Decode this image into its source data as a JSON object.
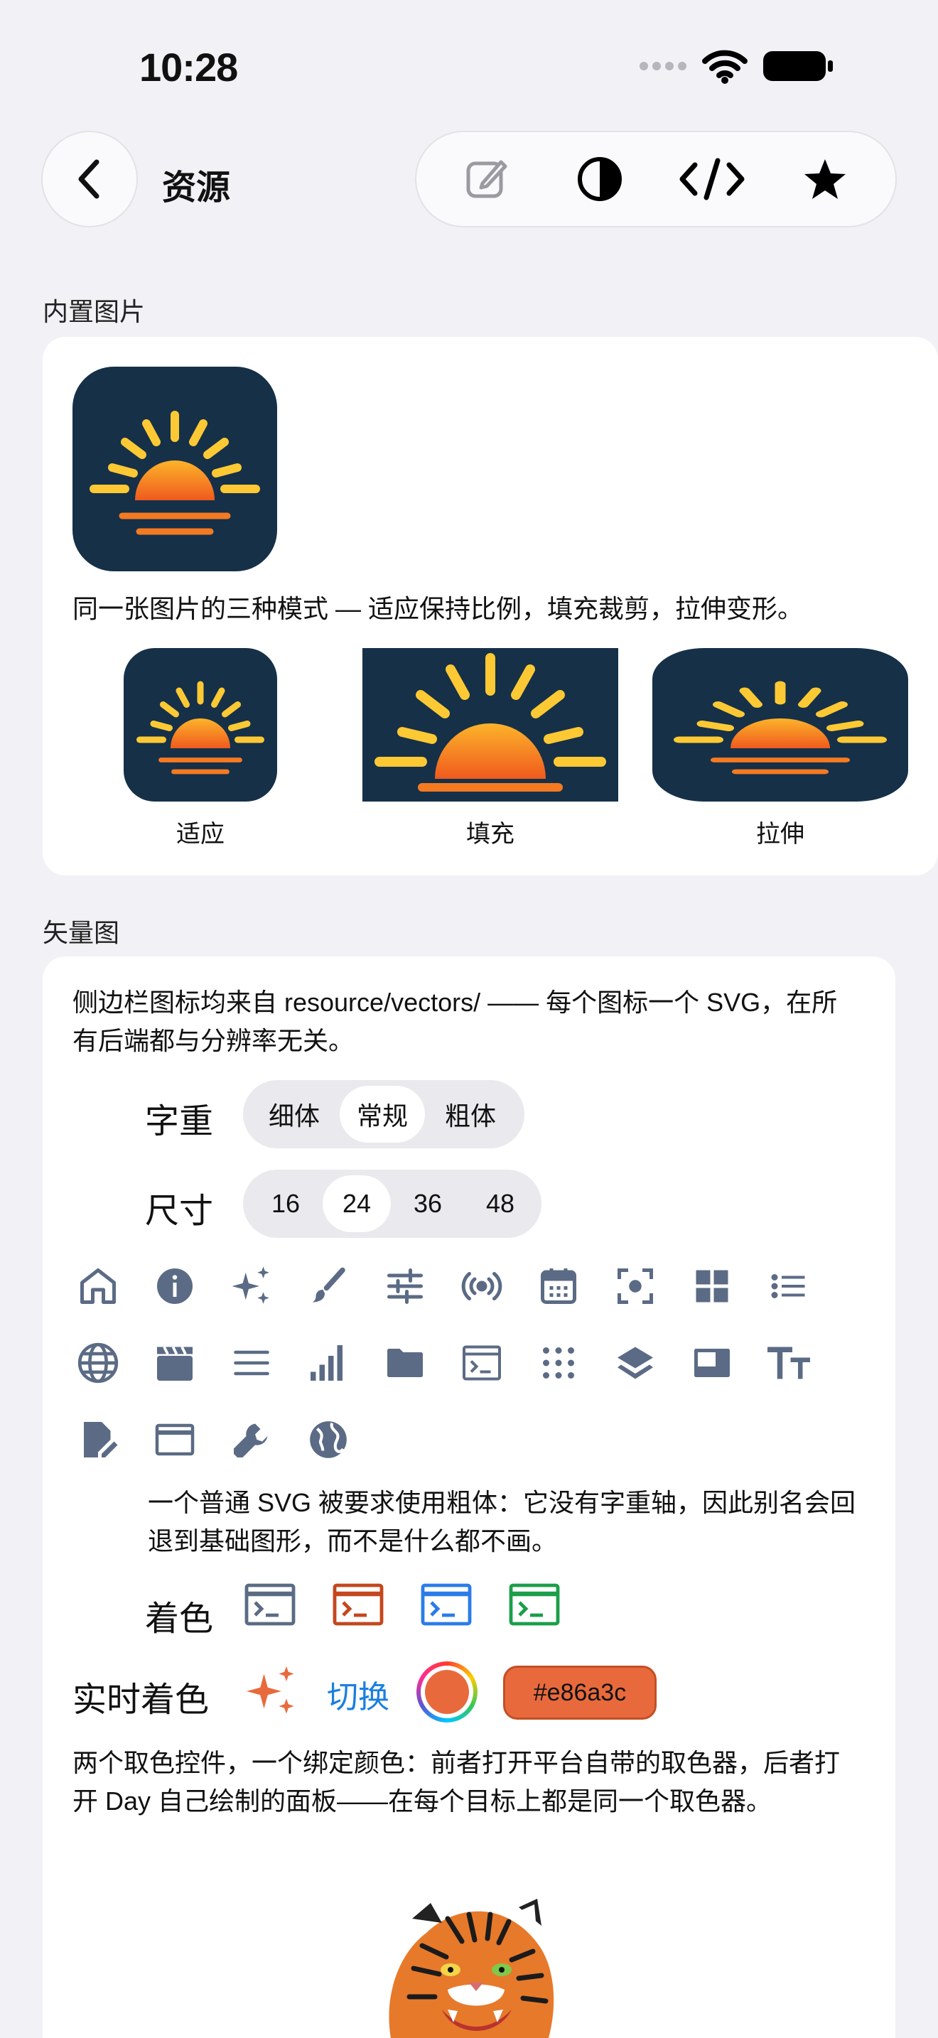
{
  "status": {
    "time": "10:28"
  },
  "nav": {
    "title": "资源"
  },
  "builtin": {
    "section_label": "内置图片",
    "description": "同一张图片的三种模式 — 适应保持比例，填充裁剪，拉伸变形。",
    "modes": [
      "适应",
      "填充",
      "拉伸"
    ]
  },
  "vectors": {
    "section_label": "矢量图",
    "intro": "侧边栏图标均来自 resource/vectors/ —— 每个图标一个 SVG，在所有后端都与分辨率无关。",
    "weight_label": "字重",
    "weights": [
      "细体",
      "常规",
      "粗体"
    ],
    "weight_selected": "常规",
    "size_label": "尺寸",
    "sizes": [
      "16",
      "24",
      "36",
      "48"
    ],
    "size_selected": "24",
    "icons": [
      "home-icon",
      "info-icon",
      "sparkles-icon",
      "brush-icon",
      "sliders-icon",
      "broadcast-icon",
      "calendar-icon",
      "focus-icon",
      "grid-icon",
      "list-icon",
      "globe-icon",
      "clapperboard-icon",
      "menu-icon",
      "bar-chart-icon",
      "folder-icon",
      "terminal-icon",
      "dots-grid-icon",
      "layers-icon",
      "window-icon",
      "text-size-icon",
      "document-edit-icon",
      "browser-window-icon",
      "wrench-icon",
      "earth-icon"
    ],
    "bold_note": "一个普通 SVG 被要求使用粗体：它没有字重轴，因此别名会回退到基础图形，而不是什么都不画。",
    "tint_label": "着色",
    "tint_colors": [
      "#5b6b85",
      "#c4471d",
      "#2b7ce9",
      "#1c9e4a"
    ],
    "live_tint_label": "实时着色",
    "toggle_label": "切换",
    "live_color": "#e86a3c",
    "hex_value": "#e86a3c",
    "picker_note": "两个取色控件，一个绑定颜色：前者打开平台自带的取色器，后者打开 Day 自己绘制的面板——在每个目标上都是同一个取色器。"
  },
  "colors": {
    "icon_gray": "#5b6b85",
    "link_blue": "#1a7fe0",
    "dark_navy": "#163048",
    "sun_orange": "#f47a22"
  }
}
